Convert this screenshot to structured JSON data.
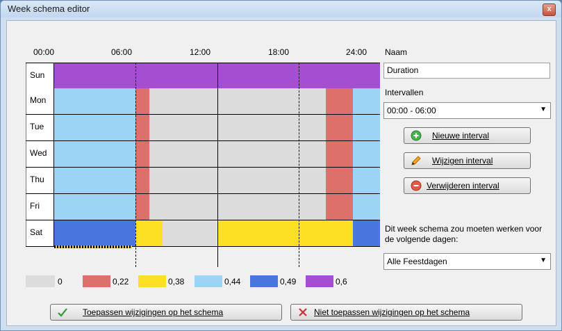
{
  "window": {
    "title": "Week schema editor",
    "close_glyph": "x"
  },
  "schedule": {
    "hours": [
      "00:00",
      "06:00",
      "12:00",
      "18:00",
      "24:00"
    ],
    "days": [
      {
        "name": "Sun",
        "segments": [
          {
            "from": 0,
            "to": 24,
            "color": "#a44fd1"
          }
        ]
      },
      {
        "name": "Mon",
        "segments": [
          {
            "from": 0,
            "to": 6,
            "color": "#9bd5f6"
          },
          {
            "from": 6,
            "to": 7,
            "color": "#de706c"
          },
          {
            "from": 7,
            "to": 20,
            "color": "#dcdcdc"
          },
          {
            "from": 20,
            "to": 22,
            "color": "#de706c"
          },
          {
            "from": 22,
            "to": 24,
            "color": "#9bd5f6"
          }
        ]
      },
      {
        "name": "Tue",
        "segments": [
          {
            "from": 0,
            "to": 6,
            "color": "#9bd5f6"
          },
          {
            "from": 6,
            "to": 7,
            "color": "#de706c"
          },
          {
            "from": 7,
            "to": 20,
            "color": "#dcdcdc"
          },
          {
            "from": 20,
            "to": 22,
            "color": "#de706c"
          },
          {
            "from": 22,
            "to": 24,
            "color": "#9bd5f6"
          }
        ]
      },
      {
        "name": "Wed",
        "segments": [
          {
            "from": 0,
            "to": 6,
            "color": "#9bd5f6"
          },
          {
            "from": 6,
            "to": 7,
            "color": "#de706c"
          },
          {
            "from": 7,
            "to": 20,
            "color": "#dcdcdc"
          },
          {
            "from": 20,
            "to": 22,
            "color": "#de706c"
          },
          {
            "from": 22,
            "to": 24,
            "color": "#9bd5f6"
          }
        ]
      },
      {
        "name": "Thu",
        "segments": [
          {
            "from": 0,
            "to": 6,
            "color": "#9bd5f6"
          },
          {
            "from": 6,
            "to": 7,
            "color": "#de706c"
          },
          {
            "from": 7,
            "to": 20,
            "color": "#dcdcdc"
          },
          {
            "from": 20,
            "to": 22,
            "color": "#de706c"
          },
          {
            "from": 22,
            "to": 24,
            "color": "#9bd5f6"
          }
        ]
      },
      {
        "name": "Fri",
        "segments": [
          {
            "from": 0,
            "to": 6,
            "color": "#9bd5f6"
          },
          {
            "from": 6,
            "to": 7,
            "color": "#de706c"
          },
          {
            "from": 7,
            "to": 20,
            "color": "#dcdcdc"
          },
          {
            "from": 20,
            "to": 22,
            "color": "#de706c"
          },
          {
            "from": 22,
            "to": 24,
            "color": "#9bd5f6"
          }
        ]
      },
      {
        "name": "Sat",
        "segments": [
          {
            "from": 0,
            "to": 6,
            "color": "#4876de"
          },
          {
            "from": 6,
            "to": 8,
            "color": "#fde023"
          },
          {
            "from": 8,
            "to": 12,
            "color": "#dcdcdc"
          },
          {
            "from": 12,
            "to": 22,
            "color": "#fde023"
          },
          {
            "from": 22,
            "to": 24,
            "color": "#4876de"
          }
        ]
      }
    ]
  },
  "legend": [
    {
      "value": "0",
      "color": "#dcdcdc"
    },
    {
      "value": "0,22",
      "color": "#de706c"
    },
    {
      "value": "0,38",
      "color": "#fde023"
    },
    {
      "value": "0,44",
      "color": "#9bd5f6"
    },
    {
      "value": "0,49",
      "color": "#4876de"
    },
    {
      "value": "0,6",
      "color": "#a44fd1"
    }
  ],
  "panel": {
    "naam_label": "Naam",
    "naam_value": "Duration",
    "intervallen_label": "Intervallen",
    "interval_selected": "00:00 - 06:00",
    "new_interval_label": "Nieuwe interval",
    "edit_interval_label": "Wijzigen interval",
    "delete_interval_label": "Verwijderen interval",
    "days_description": "Dit week schema zou moeten werken voor de volgende dagen:",
    "days_selected": "Alle Feestdagen"
  },
  "footer": {
    "apply_label": "Toepassen wijzigingen op het schema",
    "cancel_label": "Niet toepassen wijzigingen op het schema"
  },
  "icons": {
    "close": "close-icon",
    "new": "plus-circle-icon",
    "edit": "pencil-icon",
    "delete": "minus-circle-icon",
    "apply": "checkmark-icon",
    "cancel": "cross-icon",
    "dropdown": "chevron-down-icon"
  }
}
